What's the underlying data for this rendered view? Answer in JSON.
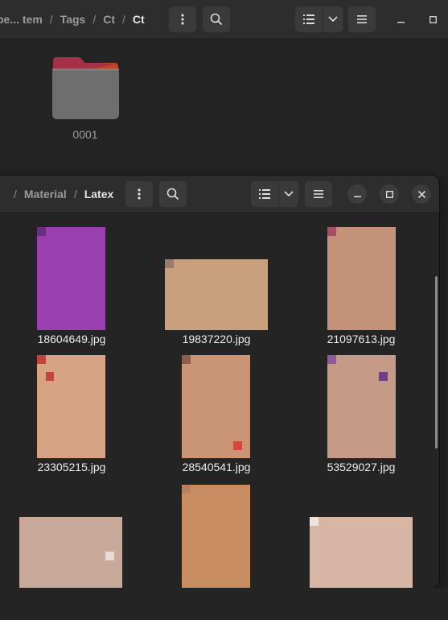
{
  "back_window": {
    "breadcrumb": [
      {
        "label": "pe... tem",
        "current": false
      },
      {
        "label": "Tags",
        "current": false
      },
      {
        "label": "Ct",
        "current": false
      },
      {
        "label": "Ct",
        "current": true
      }
    ],
    "folder": {
      "name": "0001"
    }
  },
  "front_window": {
    "breadcrumb": [
      {
        "label": "Material",
        "current": false
      },
      {
        "label": "Latex",
        "current": true
      }
    ],
    "files": [
      {
        "name": "18604649.jpg",
        "palette": [
          "#9a3fb0",
          "#c44fc4",
          "#6b2d7d",
          "#2b1f3a",
          "#b96ac9",
          "#d08fa6",
          "#4a2a56",
          "#e05fb4"
        ]
      },
      {
        "name": "19837220.jpg",
        "palette": [
          "#c9a07e",
          "#a7806e",
          "#8f6a9a",
          "#d8b8a0",
          "#6d4f7a",
          "#bfa089",
          "#e2c9b6",
          "#9b7a72"
        ]
      },
      {
        "name": "21097613.jpg",
        "palette": [
          "#c49278",
          "#e6d2c7",
          "#8a6353",
          "#d0b09b",
          "#a94d66",
          "#f0e4df",
          "#b57a66",
          "#6f4b45"
        ]
      },
      {
        "name": "23305215.jpg",
        "palette": [
          "#d7a385",
          "#c2433f",
          "#e8c8b4",
          "#a52f35",
          "#f0e1d6",
          "#b87760",
          "#d35a50",
          "#8d3a34"
        ]
      },
      {
        "name": "28540541.jpg",
        "palette": [
          "#c99575",
          "#d04a3c",
          "#e7d3c2",
          "#aa6a4f",
          "#f2e8e0",
          "#b33a31",
          "#8c5d4a",
          "#dcb596"
        ]
      },
      {
        "name": "53529027.jpg",
        "palette": [
          "#c59a87",
          "#6b3e8e",
          "#e6d6cf",
          "#8d5aa0",
          "#d2b4a4",
          "#4a2f5c",
          "#b08070",
          "#f0e6e0"
        ]
      },
      {
        "name": "",
        "palette": [
          "#c8a99a",
          "#e8dad4",
          "#a88a8c",
          "#f4ece8",
          "#b99aa6",
          "#8a6f6c",
          "#d7c3bd",
          "#9c7f86"
        ]
      },
      {
        "name": "",
        "palette": [
          "#c98d62",
          "#a8683e",
          "#e9d2bb",
          "#7a5038",
          "#f2e6da",
          "#b7845d",
          "#4a7ea8",
          "#d4a780"
        ]
      },
      {
        "name": "",
        "palette": [
          "#d8b6a6",
          "#c23848",
          "#f0e2dc",
          "#a82b3a",
          "#e6ccc0",
          "#b8808a",
          "#d4505c",
          "#f6eeea"
        ]
      }
    ]
  },
  "icons": {
    "menu": "kebab-menu-icon",
    "search": "search-icon",
    "view": "list-view-icon",
    "dropdown": "chevron-down-icon",
    "hamburger": "hamburger-menu-icon",
    "minimize": "minimize-icon",
    "maximize": "maximize-icon",
    "close": "close-icon"
  }
}
